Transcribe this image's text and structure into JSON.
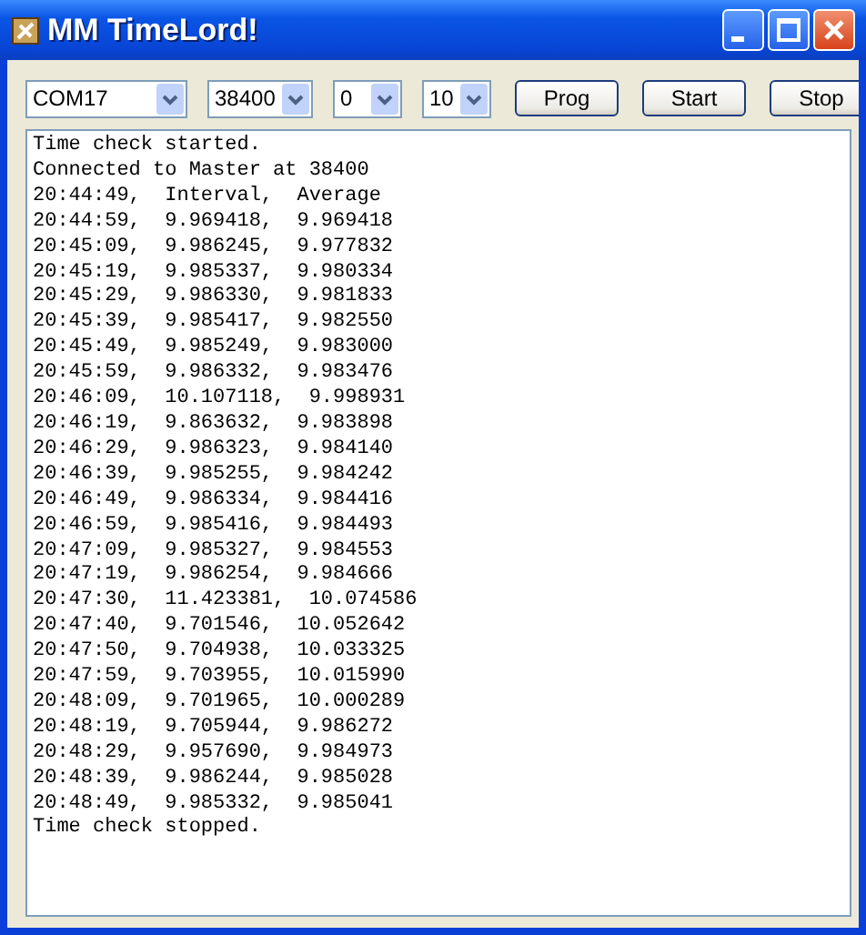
{
  "window": {
    "title": "MM TimeLord!"
  },
  "toolbar": {
    "dropdowns": [
      {
        "value": "COM17"
      },
      {
        "value": "38400"
      },
      {
        "value": "0"
      },
      {
        "value": "10"
      }
    ],
    "buttons": [
      "Prog",
      "Start",
      "Stop"
    ]
  },
  "log": {
    "lines": [
      "Time check started.",
      "Connected to Master at 38400",
      "20:44:49,  Interval,  Average",
      "20:44:59,  9.969418,  9.969418",
      "20:45:09,  9.986245,  9.977832",
      "20:45:19,  9.985337,  9.980334",
      "20:45:29,  9.986330,  9.981833",
      "20:45:39,  9.985417,  9.982550",
      "20:45:49,  9.985249,  9.983000",
      "20:45:59,  9.986332,  9.983476",
      "20:46:09,  10.107118,  9.998931",
      "20:46:19,  9.863632,  9.983898",
      "20:46:29,  9.986323,  9.984140",
      "20:46:39,  9.985255,  9.984242",
      "20:46:49,  9.986334,  9.984416",
      "20:46:59,  9.985416,  9.984493",
      "20:47:09,  9.985327,  9.984553",
      "20:47:19,  9.986254,  9.984666",
      "20:47:30,  11.423381,  10.074586",
      "20:47:40,  9.701546,  10.052642",
      "20:47:50,  9.704938,  10.033325",
      "20:47:59,  9.703955,  10.015990",
      "20:48:09,  9.701965,  10.000289",
      "20:48:19,  9.705944,  9.986272",
      "20:48:29,  9.957690,  9.984973",
      "20:48:39,  9.986244,  9.985028",
      "20:48:49,  9.985332,  9.985041",
      "Time check stopped."
    ]
  }
}
